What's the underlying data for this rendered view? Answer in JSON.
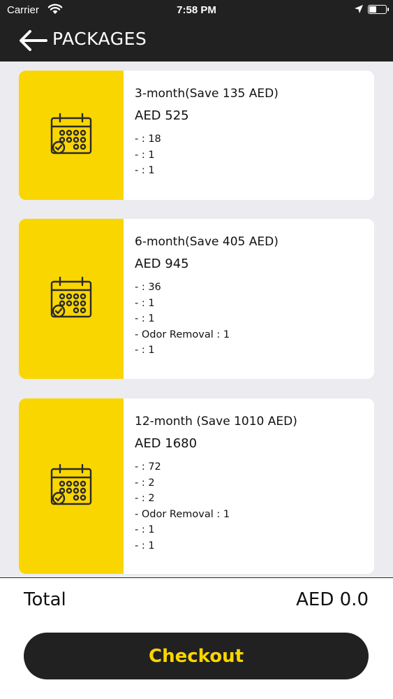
{
  "status_bar": {
    "carrier": "Carrier",
    "time": "7:58 PM"
  },
  "nav": {
    "title": "PACKAGES"
  },
  "colors": {
    "accent": "#fad600",
    "dark": "#212121",
    "background": "#ebebf0"
  },
  "packages": [
    {
      "name": "3-month(Save 135 AED)",
      "price": "AED 525",
      "icon": "calendar-check-icon",
      "features": [
        "- : 18",
        "- : 1",
        "- : 1"
      ]
    },
    {
      "name": "6-month(Save 405 AED)",
      "price": "AED 945",
      "icon": "calendar-check-icon",
      "features": [
        "- : 36",
        "- : 1",
        "- : 1",
        "- Odor Removal : 1",
        "- : 1"
      ]
    },
    {
      "name": "12-month (Save 1010 AED)",
      "price": "AED 1680",
      "icon": "calendar-check-icon",
      "features": [
        "- : 72",
        "- : 2",
        "- : 2",
        "- Odor Removal : 1",
        "- : 1",
        "- : 1"
      ]
    }
  ],
  "footer": {
    "total_label": "Total",
    "total_value": "AED 0.0",
    "checkout_label": "Checkout"
  }
}
